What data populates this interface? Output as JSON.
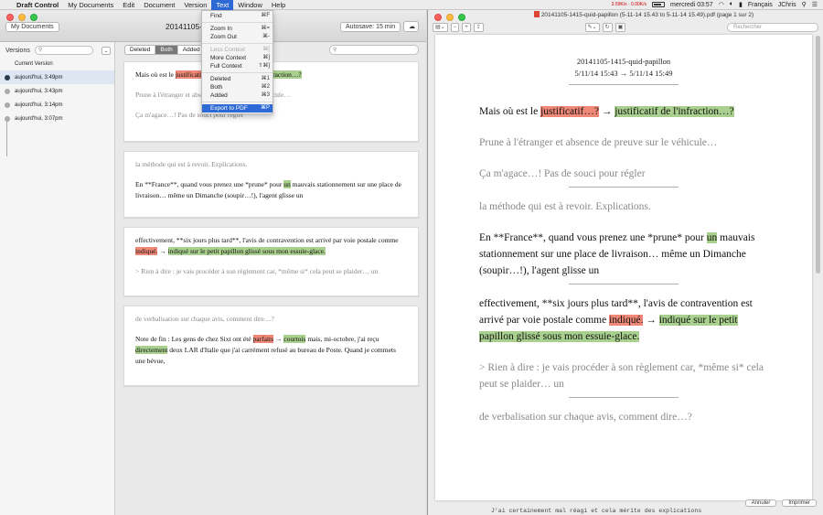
{
  "menubar": {
    "app": "Draft Control",
    "items": [
      "My Documents",
      "Edit",
      "Document",
      "Version",
      "Text",
      "Window",
      "Help"
    ],
    "active": "Text",
    "status": {
      "time": "mercredi 03:57",
      "lang": "Français",
      "user": "JChris",
      "net": "3.59K/s · 0.00K/s"
    }
  },
  "left": {
    "my_docs_button": "My Documents",
    "doc_title": "20141105-",
    "autosave": "Autosave: 15 min",
    "versions_label": "Versions",
    "versions": [
      {
        "label": "Current Version"
      },
      {
        "label": "aujourd'hui, 3:49pm"
      },
      {
        "label": "aujourd'hui, 3:43pm"
      },
      {
        "label": "aujourd'hui, 3:14pm"
      },
      {
        "label": "aujourd'hui, 3:07pm"
      }
    ],
    "segments": [
      "Deleted",
      "Both",
      "Added"
    ],
    "selected_segment": "Both",
    "cards": [
      {
        "p1": {
          "a": "Mais où est le ",
          "red": "justificatif…? → ",
          "green": "justificatif de l'infraction…?"
        },
        "p2": "Prune à l'étranger et absence de preuve sur le véhicule…",
        "p3": "Ça m'agace…! Pas de souci pour régler"
      },
      {
        "p1": "la méthode qui est à revoir. Explications.",
        "p2a": "En **France**, quand vous prenez une *prune* pour ",
        "p2green": "un",
        "p2b": " mauvais stationnement sur une place de livraison… même un Dimanche (soupir…!), l'agent glisse un"
      },
      {
        "p1": "effectivement, **six jours plus tard**, l'avis de contravention est arrivé par voie postale comme ",
        "red": "indiqué.",
        "arrow": " → ",
        "green": "indiqué sur le petit papillon glissé sous mon essuie-glace.",
        "p2": "> Rien à dire : je vais procéder à son règlement car, *même si* cela peut se plaider… un"
      },
      {
        "p1": "de verbalisation sur chaque avis, comment dire…?",
        "p2a": "Note de fin : Les gens de chez Sixt ont été ",
        "red": "parfaits",
        "arrow": " → ",
        "green1": "courtois",
        "p2b": " mais, mi-octobre, j'ai reçu ",
        "green2": "directement",
        "p2c": " deux LAR d'Italie que j'ai carrément refusé au bureau de Poste. Quand je commets une bévue,"
      }
    ]
  },
  "text_menu": {
    "items": [
      {
        "label": "Find",
        "key": "⌘F",
        "state": "normal"
      },
      {
        "sep": true
      },
      {
        "label": "Zoom In",
        "key": "⌘=",
        "state": "normal"
      },
      {
        "label": "Zoom Out",
        "key": "⌘-",
        "state": "normal"
      },
      {
        "sep": true
      },
      {
        "label": "Less Context",
        "key": "⌘[",
        "state": "disabled"
      },
      {
        "label": "More Context",
        "key": "⌘]",
        "state": "normal"
      },
      {
        "label": "Full Context",
        "key": "⇧⌘]",
        "state": "normal"
      },
      {
        "sep": true
      },
      {
        "label": "Deleted",
        "key": "⌘1",
        "state": "normal"
      },
      {
        "label": "Both",
        "key": "⌘2",
        "state": "normal"
      },
      {
        "label": "Added",
        "key": "⌘3",
        "state": "normal"
      },
      {
        "sep": true
      },
      {
        "label": "Export to PDF",
        "key": "⌘P",
        "state": "highlighted"
      }
    ]
  },
  "right": {
    "window_title": "20141105-1415-quid-papillon (5-11-14 15.43 to 5-11-14 15.49).pdf (page 1 sur 2)",
    "search_placeholder": "Rechercher",
    "header1": "20141105-1415-quid-papillon",
    "header2": "5/11/14 15:43 → 5/11/14 15:49",
    "rule": "———————————————",
    "p1a": "Mais où est le ",
    "p1red": "justificatif…?",
    "p1arrow": " → ",
    "p1green": "justificatif de l'infraction…?",
    "p2": "Prune à l'étranger et absence de preuve sur le véhicule…",
    "p3": "Ça m'agace…! Pas de souci pour régler",
    "p4": "la méthode qui est à revoir. Explications.",
    "p5a": "En **France**, quand vous prenez une *prune* pour ",
    "p5green": "un",
    "p5b": " mauvais stationnement sur une place de livraison… même un Dimanche (soupir…!), l'agent glisse un",
    "p6a": "effectivement, **six jours plus tard**, l'avis de contravention est arrivé par voie postale comme ",
    "p6red": "indiqué.",
    "p6arrow": " → ",
    "p6green": "indiqué sur le petit papillon glissé sous mon essuie-glace.",
    "p7": "> Rien à dire : je vais procéder à son règlement car, *même si* cela peut se plaider… un",
    "p8": "de verbalisation sur chaque avis, comment dire…?",
    "cancel": "Annuler",
    "print": "Imprimer"
  },
  "background_text": "J'ai certainement mal réagi et cela mérite des explications",
  "colors": {
    "deleted": "#f08878",
    "added": "#a9d08e",
    "accent": "#2d6ad6"
  }
}
